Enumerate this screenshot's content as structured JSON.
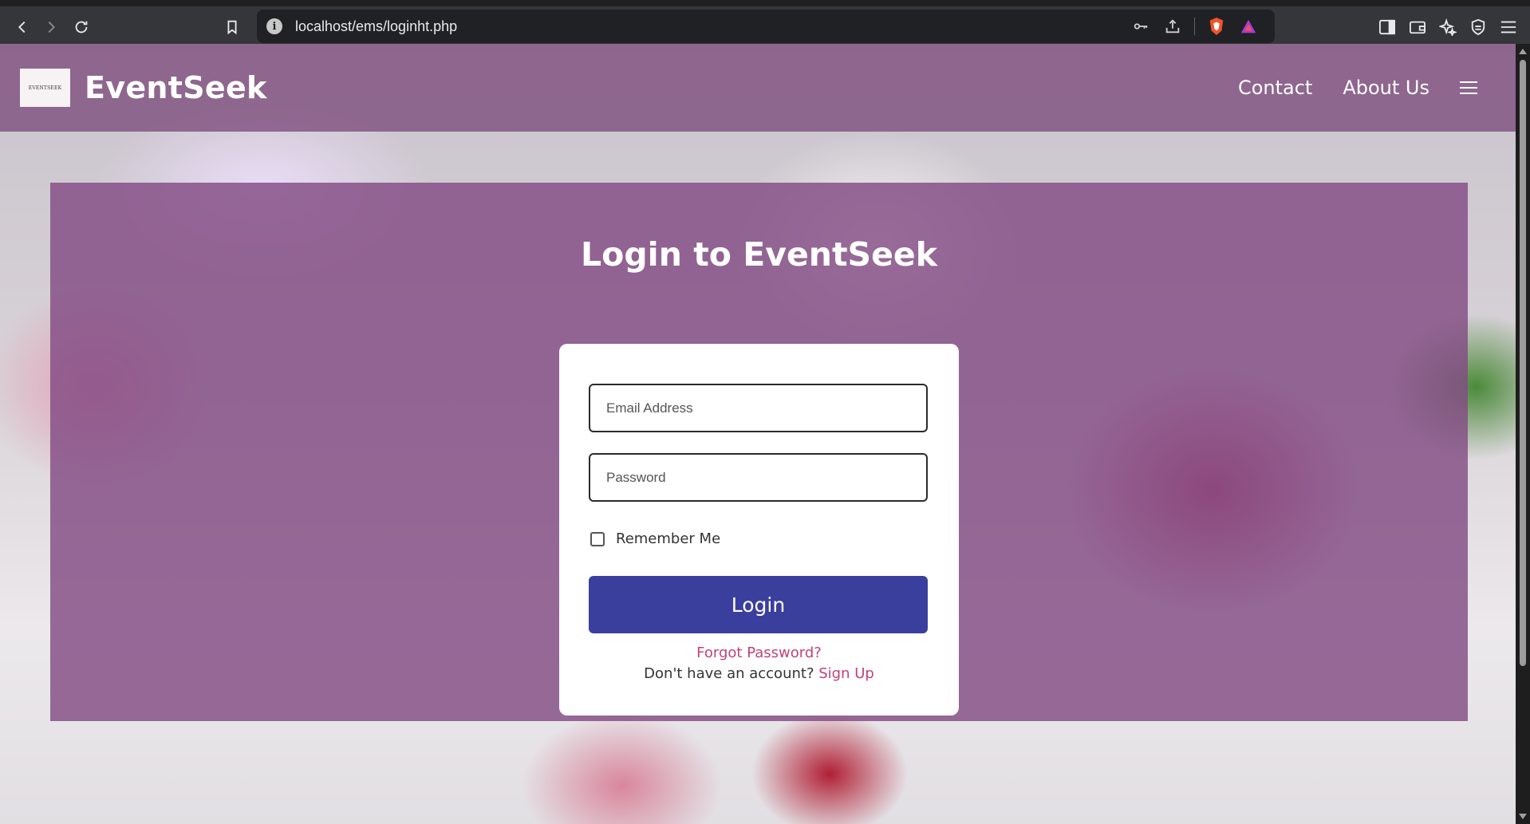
{
  "browser": {
    "url": "localhost/ems/loginht.php"
  },
  "header": {
    "logo_text": "EVENTSEEK",
    "brand": "EventSeek",
    "nav": {
      "contact": "Contact",
      "about": "About Us"
    }
  },
  "login": {
    "title": "Login to EventSeek",
    "email_placeholder": "Email Address",
    "password_placeholder": "Password",
    "remember_label": "Remember Me",
    "login_button": "Login",
    "forgot_link": "Forgot Password?",
    "signup_prompt": "Don't have an account?",
    "signup_link": "Sign Up"
  },
  "colors": {
    "header_overlay": "#805280",
    "panel_overlay": "#824c84",
    "button": "#3a3f9e",
    "link": "#c0427a"
  },
  "icons": [
    "back-icon",
    "forward-icon",
    "reload-icon",
    "bookmark-icon",
    "info-icon",
    "key-icon",
    "share-icon",
    "brave-shield-icon",
    "rewards-icon",
    "sidebar-icon",
    "wallet-icon",
    "leo-icon",
    "vpn-icon",
    "menu-icon",
    "hamburger-icon"
  ]
}
